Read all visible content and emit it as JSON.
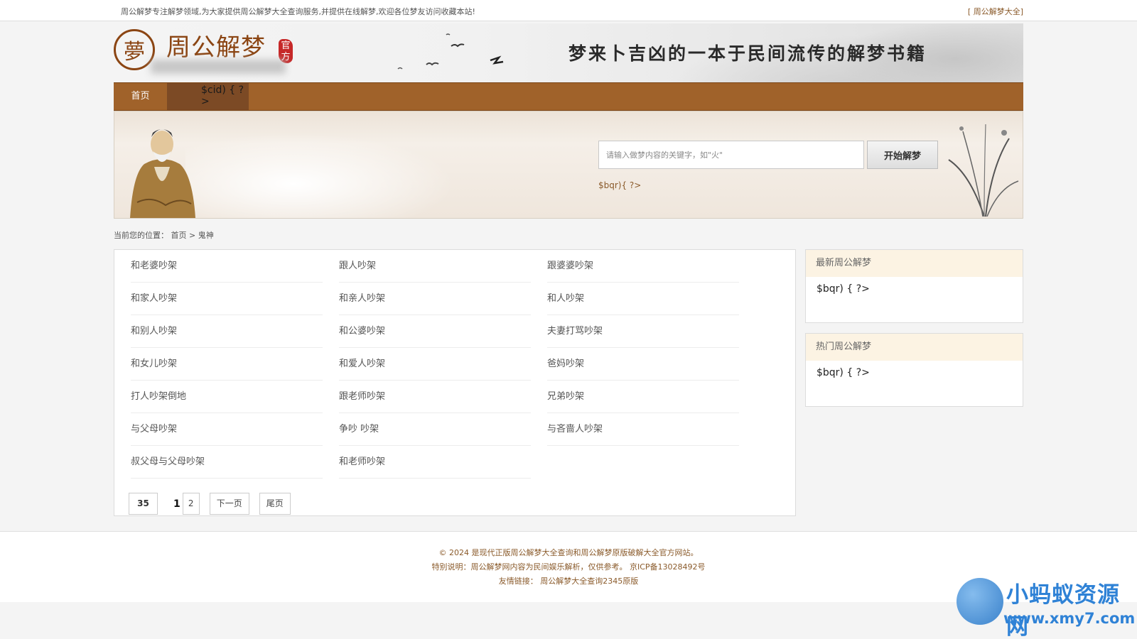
{
  "topbar": {
    "notice": "周公解梦专注解梦领域,为大家提供周公解梦大全查询服务,并提供在线解梦,欢迎各位梦友访问收藏本站!",
    "link": "[ 周公解梦大全]"
  },
  "header": {
    "seal_char": "夢",
    "site_title": "周公解梦",
    "stamp_text": "官方",
    "slogan": "梦来卜吉凶的一本于民间流传的解梦书籍"
  },
  "nav": {
    "home": "首页",
    "category_placeholder": "$cid) { ?>"
  },
  "search": {
    "placeholder": "请输入做梦内容的关键字，如\"火\"",
    "button": "开始解梦",
    "hot_placeholder": "$bqr){ ?>"
  },
  "breadcrumb": {
    "prefix": "当前您的位置：",
    "home": "首页",
    "sep": ">",
    "current": "鬼神"
  },
  "list": {
    "items": [
      "和老婆吵架",
      "跟人吵架",
      "跟婆婆吵架",
      "和家人吵架",
      "和亲人吵架",
      "和人吵架",
      "和别人吵架",
      "和公婆吵架",
      "夫妻打骂吵架",
      "和女儿吵架",
      "和爱人吵架",
      "爸妈吵架",
      "打人吵架倒地",
      "跟老师吵架",
      "兄弟吵架",
      "与父母吵架",
      "争吵  吵架",
      "与吝啬人吵架",
      "叔父母与父母吵架",
      "和老师吵架"
    ]
  },
  "pagination": {
    "total": "35",
    "current": "1",
    "page2": "2",
    "next": "下一页",
    "last": "尾页"
  },
  "sidebar": {
    "latest_title": "最新周公解梦",
    "latest_placeholder": "$bqr) { ?>",
    "hot_title": "热门周公解梦",
    "hot_placeholder": "$bqr) { ?>"
  },
  "footer": {
    "line1": "© 2024 是现代正版周公解梦大全查询和周公解梦原版破解大全官方网站。",
    "line2": "特别说明：周公解梦网内容为民间娱乐解析，仅供参考。 京ICP备13028492号",
    "links_prefix": "友情链接：",
    "link1": "周公解梦大全查询2345原版"
  },
  "watermark": {
    "title": "小蚂蚁资源网",
    "url": "www.xmy7.com"
  },
  "colors": {
    "brand_brown": "#a0622a",
    "nav_active": "#7c4a25",
    "seal_red": "#c62828",
    "watermark_blue": "#2f82d6"
  }
}
